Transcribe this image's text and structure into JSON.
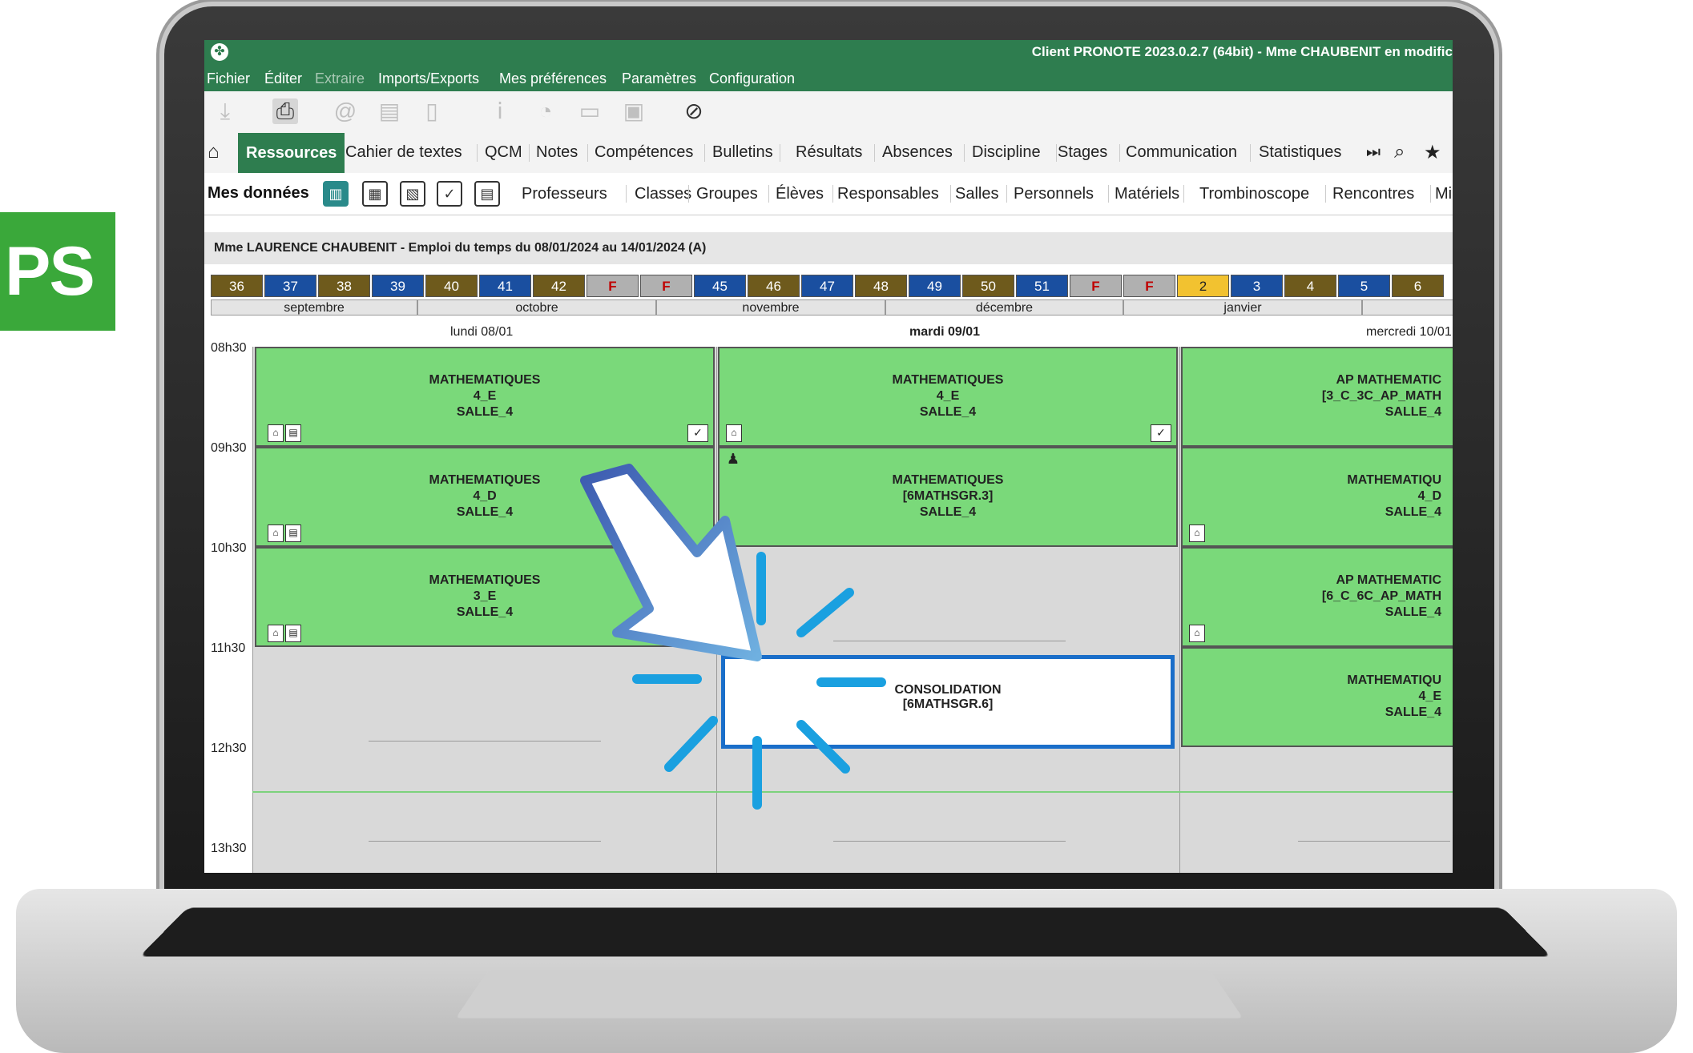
{
  "badge": {
    "text": "PS"
  },
  "titlebar": {
    "title": "Client PRONOTE 2023.0.2.7 (64bit) - Mme CHAUBENIT en modific"
  },
  "menu": {
    "items": [
      "Fichier",
      "Éditer",
      "Extraire",
      "Imports/Exports",
      "Mes préférences",
      "Paramètres",
      "Configuration"
    ]
  },
  "toolbar": {
    "icons": [
      "download-icon",
      "print-icon",
      "email-icon",
      "document-icon",
      "phone-icon",
      "info-icon",
      "pie-chart-icon",
      "message-icon",
      "archive-icon",
      "alert-icon"
    ]
  },
  "nav": {
    "tabs": [
      "Ressources",
      "Cahier de textes",
      "QCM",
      "Notes",
      "Compétences",
      "Bulletins",
      "Résultats",
      "Absences",
      "Discipline",
      "Stages",
      "Communication",
      "Statistiques"
    ]
  },
  "subnav": {
    "mine": "Mes données",
    "items": [
      "Professeurs",
      "Classes",
      "Groupes",
      "Élèves",
      "Responsables",
      "Salles",
      "Personnels",
      "Matériels",
      "Trombinoscope",
      "Rencontres",
      "Mi"
    ]
  },
  "info": {
    "text": "Mme LAURENCE CHAUBENIT - Emploi du temps du 08/01/2024 au 14/01/2024 (A)"
  },
  "weeks": [
    {
      "label": "36",
      "kind": "brown"
    },
    {
      "label": "37",
      "kind": "blue"
    },
    {
      "label": "38",
      "kind": "brown"
    },
    {
      "label": "39",
      "kind": "blue"
    },
    {
      "label": "40",
      "kind": "brown"
    },
    {
      "label": "41",
      "kind": "blue"
    },
    {
      "label": "42",
      "kind": "brown"
    },
    {
      "label": "F",
      "kind": "gray"
    },
    {
      "label": "F",
      "kind": "gray"
    },
    {
      "label": "45",
      "kind": "blue"
    },
    {
      "label": "46",
      "kind": "brown"
    },
    {
      "label": "47",
      "kind": "blue"
    },
    {
      "label": "48",
      "kind": "brown"
    },
    {
      "label": "49",
      "kind": "blue"
    },
    {
      "label": "50",
      "kind": "brown"
    },
    {
      "label": "51",
      "kind": "blue"
    },
    {
      "label": "F",
      "kind": "gray"
    },
    {
      "label": "F",
      "kind": "gray"
    },
    {
      "label": "2",
      "kind": "cur"
    },
    {
      "label": "3",
      "kind": "blue"
    },
    {
      "label": "4",
      "kind": "brown"
    },
    {
      "label": "5",
      "kind": "blue"
    },
    {
      "label": "6",
      "kind": "brown"
    }
  ],
  "months": [
    "septembre",
    "octobre",
    "novembre",
    "décembre",
    "janvier"
  ],
  "times": [
    "08h30",
    "09h30",
    "10h30",
    "11h30",
    "12h30",
    "13h30"
  ],
  "days": [
    "lundi 08/01",
    "mardi 09/01",
    "mercredi 10/01"
  ],
  "courses": {
    "mon1": [
      "MATHEMATIQUES",
      "4_E",
      "SALLE_4"
    ],
    "mon2": [
      "MATHEMATIQUES",
      "4_D",
      "SALLE_4"
    ],
    "mon3": [
      "MATHEMATIQUES",
      "3_E",
      "SALLE_4"
    ],
    "tue1": [
      "MATHEMATIQUES",
      "4_E",
      "SALLE_4"
    ],
    "tue2": [
      "MATHEMATIQUES",
      "[6MATHSGR.3]",
      "SALLE_4"
    ],
    "wed1": [
      "AP MATHEMATIC",
      "[3_C_3C_AP_MATH",
      "SALLE_4"
    ],
    "wed2": [
      "MATHEMATIQU",
      "4_D",
      "SALLE_4"
    ],
    "wed3": [
      "AP MATHEMATIC",
      "[6_C_6C_AP_MATH",
      "SALLE_4"
    ],
    "wed4": [
      "MATHEMATIQU",
      "4_E",
      "SALLE_4"
    ]
  },
  "selected": [
    "CONSOLIDATION",
    "[6MATHSGR.6]"
  ],
  "colors": {
    "pronote_green": "#2e7d4f",
    "course_green": "#7ad97a",
    "highlight_blue": "#1a6ec9"
  }
}
